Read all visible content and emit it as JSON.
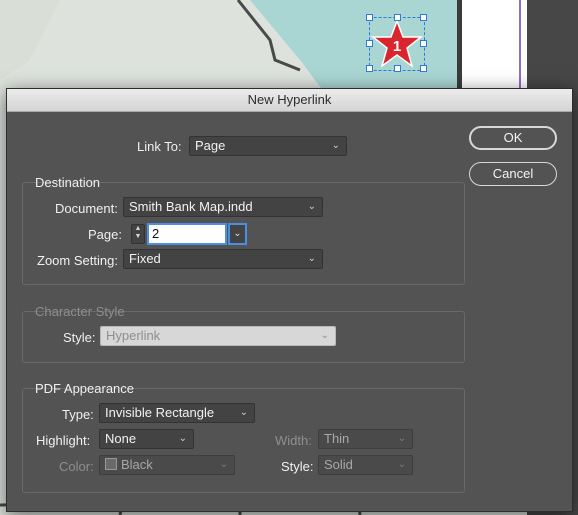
{
  "dialog": {
    "title": "New Hyperlink",
    "link_to_label": "Link To:",
    "link_to_value": "Page",
    "ok_label": "OK",
    "cancel_label": "Cancel"
  },
  "destination": {
    "title": "Destination",
    "document_label": "Document:",
    "document_value": "Smith Bank Map.indd",
    "page_label": "Page:",
    "page_value": "2",
    "zoom_label": "Zoom Setting:",
    "zoom_value": "Fixed"
  },
  "character_style": {
    "title": "Character Style",
    "style_label": "Style:",
    "style_value": "Hyperlink"
  },
  "pdf_appearance": {
    "title": "PDF Appearance",
    "type_label": "Type:",
    "type_value": "Invisible Rectangle",
    "highlight_label": "Highlight:",
    "highlight_value": "None",
    "width_label": "Width:",
    "width_value": "Thin",
    "color_label": "Color:",
    "color_value": "Black",
    "style_label": "Style:",
    "style_value": "Solid"
  },
  "canvas": {
    "star_number": "1",
    "star_color": "#d9262e",
    "selection_color": "#2f7bd8"
  }
}
